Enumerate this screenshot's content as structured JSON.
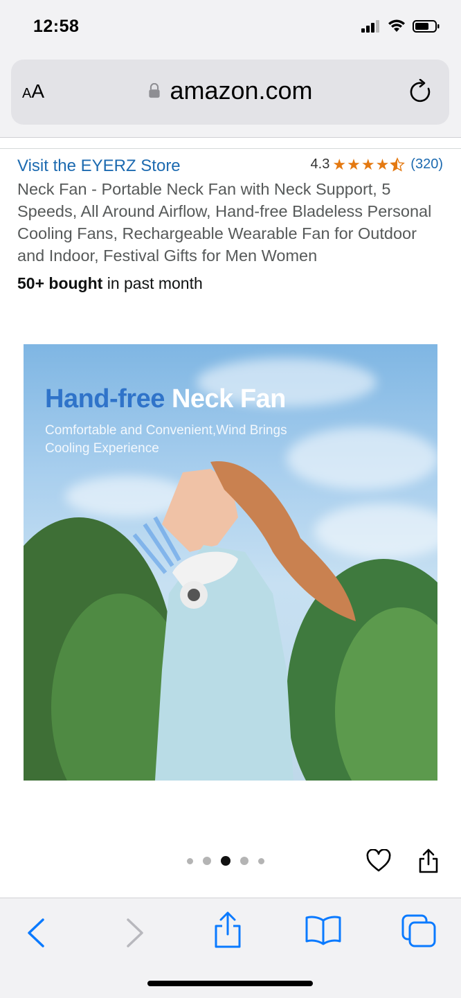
{
  "status_bar": {
    "time": "12:58"
  },
  "browser": {
    "aa_label_small": "A",
    "aa_label_large": "A",
    "url": "amazon.com"
  },
  "product": {
    "store_link": "Visit the EYERZ Store",
    "rating_value": "4.3",
    "stars": 4.5,
    "rating_count": "(320)",
    "title": "Neck Fan - Portable Neck Fan with Neck Support, 5 Speeds, All Around Airflow, Hand-free Bladeless Personal Cooling Fans, Rechargeable Wearable Fan for Outdoor and Indoor, Festival Gifts for Men Women",
    "bought_bold": "50+ bought",
    "bought_rest": " in past month"
  },
  "image": {
    "title_part1": "Hand-free",
    "title_part2": "Neck Fan",
    "subtitle": "Comfortable and Convenient,Wind Brings Cooling Experience",
    "carousel_total": 5,
    "carousel_active": 3
  },
  "icons": {
    "lock": "lock-icon",
    "reload": "reload-icon",
    "heart": "heart-icon",
    "share": "share-icon",
    "back": "back-icon",
    "forward": "forward-icon",
    "bookmarks": "bookmarks-icon",
    "tabs": "tabs-icon"
  },
  "colors": {
    "link": "#1c6ab0",
    "star": "#e47911",
    "toolbar_icon": "#0a7aff",
    "toolbar_disabled": "#b8b8bd"
  }
}
